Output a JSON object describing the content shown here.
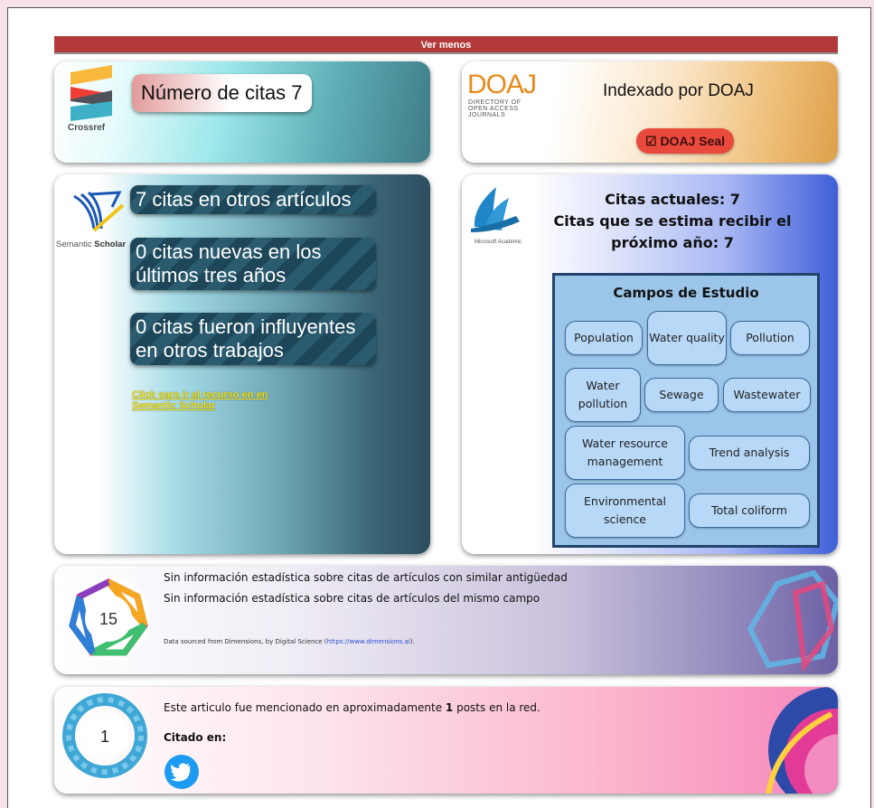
{
  "toggle": {
    "label": "Ver menos"
  },
  "crossref": {
    "logo_text": "Crossref",
    "citations_label": "Número de citas 7"
  },
  "doaj": {
    "logo_text": "DOAJ",
    "logo_subtext": [
      "DIRECTORY OF",
      "OPEN ACCESS",
      "JOURNALS"
    ],
    "title": "Indexado por DOAJ",
    "seal_icon": "checkbox-icon",
    "seal_label": "☑ DOAJ Seal"
  },
  "semantic_scholar": {
    "logo_text_a": "Semantic ",
    "logo_text_b": "Scholar",
    "stats": [
      "7 citas en otros artículos",
      "0 citas nuevas en los últimos tres años",
      "0 citas fueron influyentes en otros trabajos"
    ],
    "link_text": "Click para ir al recurso en en Semantic Scholar"
  },
  "microsoft_academic": {
    "logo_text": "Microsoft Academic",
    "current_citations": "Citas actuales: 7",
    "estimated_citations": "Citas que se estima recibir el próximo año: 7",
    "fields_title": "Campos de Estudio",
    "fields": [
      "Population",
      "Water quality",
      "Pollution",
      "Water pollution",
      "Sewage",
      "Wastewater",
      "Water resource management",
      "Trend analysis",
      "Environmental science",
      "Total coliform"
    ]
  },
  "dimensions": {
    "badge_value": "15",
    "line1": "Sin información estadística sobre citas de artículos con similar antigüedad",
    "line2": "Sin información estadística sobre citas de artículos del mismo campo",
    "source_prefix": "Data sourced from Dimensions, by Digital Science (",
    "source_link": "https://www.dimensions.ai",
    "source_suffix": ")."
  },
  "altmetric": {
    "badge_value": "1",
    "line1_prefix": "Este articulo fue mencionado en aproximadamente ",
    "line1_count": "1",
    "line1_suffix": " posts en la red.",
    "cited_in": "Citado en:",
    "social_icon": "twitter-icon"
  }
}
